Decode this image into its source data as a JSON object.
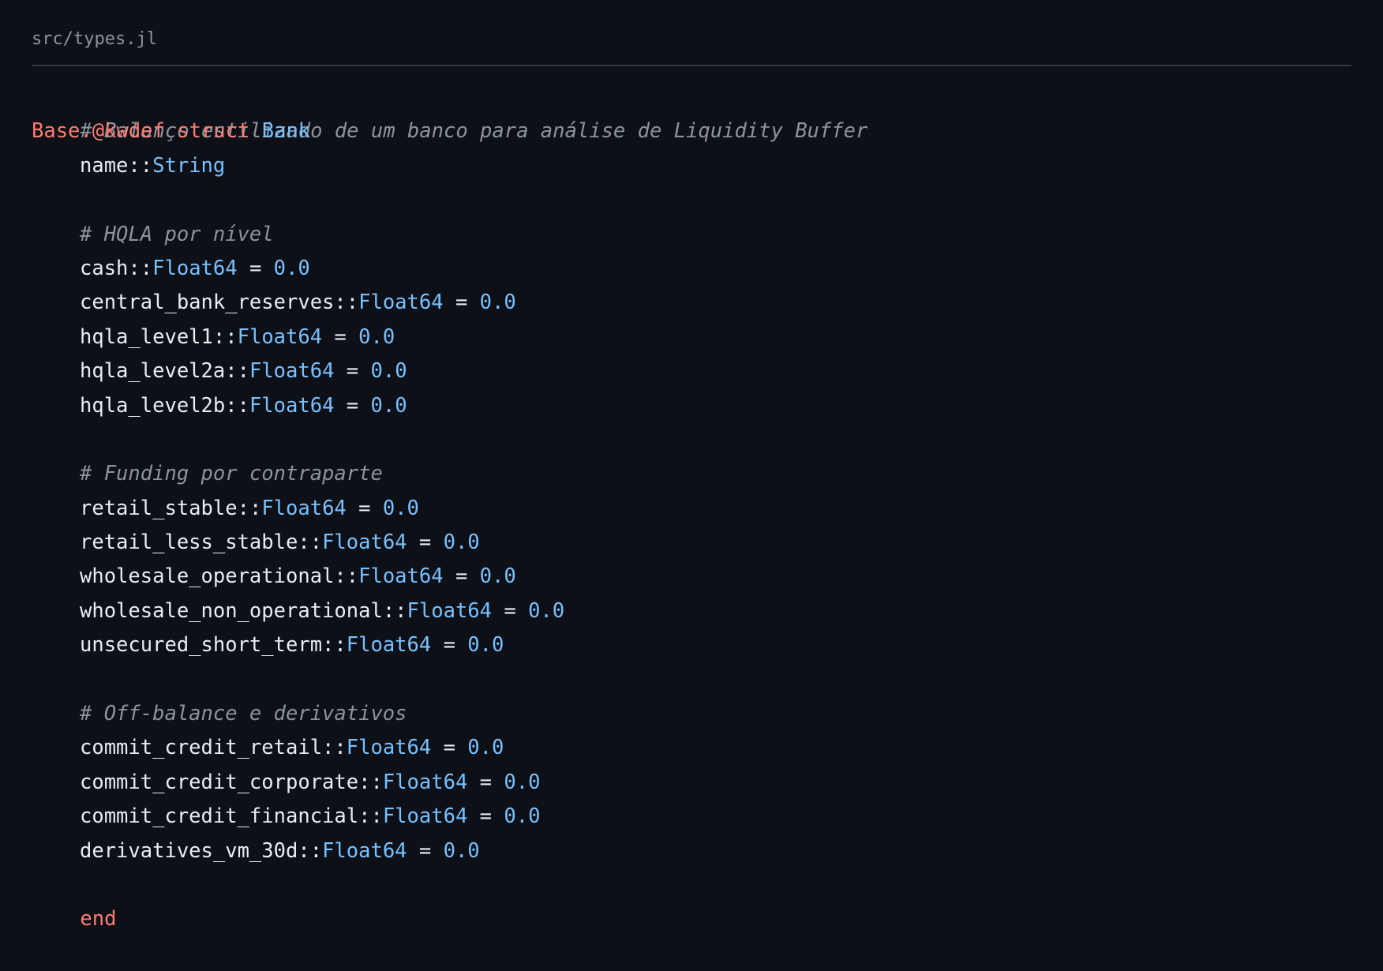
{
  "file": {
    "path": "src/types.jl"
  },
  "code": {
    "header_comment": "# Balanço estilizado de um banco para análise de Liquidity Buffer",
    "macro": "Base.@kwdef",
    "struct_kw": "struct",
    "struct_name": "Bank",
    "end_kw": "end",
    "name_field": {
      "name": "name",
      "sep": "::",
      "type": "String"
    },
    "groups": [
      {
        "comment": "# HQLA por nível",
        "fields": [
          {
            "name": "cash",
            "sep": "::",
            "type": "Float64",
            "eq": " = ",
            "value": "0.0"
          },
          {
            "name": "central_bank_reserves",
            "sep": "::",
            "type": "Float64",
            "eq": " = ",
            "value": "0.0"
          },
          {
            "name": "hqla_level1",
            "sep": "::",
            "type": "Float64",
            "eq": " = ",
            "value": "0.0"
          },
          {
            "name": "hqla_level2a",
            "sep": "::",
            "type": "Float64",
            "eq": " = ",
            "value": "0.0"
          },
          {
            "name": "hqla_level2b",
            "sep": "::",
            "type": "Float64",
            "eq": " = ",
            "value": "0.0"
          }
        ]
      },
      {
        "comment": "# Funding por contraparte",
        "fields": [
          {
            "name": "retail_stable",
            "sep": "::",
            "type": "Float64",
            "eq": " = ",
            "value": "0.0"
          },
          {
            "name": "retail_less_stable",
            "sep": "::",
            "type": "Float64",
            "eq": " = ",
            "value": "0.0"
          },
          {
            "name": "wholesale_operational",
            "sep": "::",
            "type": "Float64",
            "eq": " = ",
            "value": "0.0"
          },
          {
            "name": "wholesale_non_operational",
            "sep": "::",
            "type": "Float64",
            "eq": " = ",
            "value": "0.0"
          },
          {
            "name": "unsecured_short_term",
            "sep": "::",
            "type": "Float64",
            "eq": " = ",
            "value": "0.0"
          }
        ]
      },
      {
        "comment": "# Off-balance e derivativos",
        "fields": [
          {
            "name": "commit_credit_retail",
            "sep": "::",
            "type": "Float64",
            "eq": " = ",
            "value": "0.0"
          },
          {
            "name": "commit_credit_corporate",
            "sep": "::",
            "type": "Float64",
            "eq": " = ",
            "value": "0.0"
          },
          {
            "name": "commit_credit_financial",
            "sep": "::",
            "type": "Float64",
            "eq": " = ",
            "value": "0.0"
          },
          {
            "name": "derivatives_vm_30d",
            "sep": "::",
            "type": "Float64",
            "eq": " = ",
            "value": "0.0"
          }
        ]
      }
    ]
  },
  "colors": {
    "background": "#0d1117",
    "comment": "#8b949e",
    "keyword": "#ff7b72",
    "type": "#79c0ff",
    "text": "#e6edf3"
  }
}
